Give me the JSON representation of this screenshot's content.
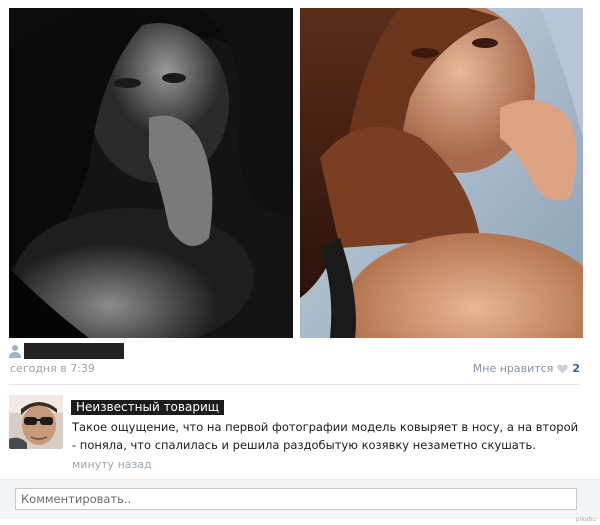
{
  "post": {
    "author_name": "",
    "time": "сегодня в 7:39",
    "like_label": "Мне нравится",
    "like_count": "2"
  },
  "comment": {
    "author": "Неизвестный товарищ",
    "text": "Такое ощущение, что на первой фотографии модель ковыряет в носу, а на второй - поняла, что спалилась и решила раздобытую козявку незаметно скушать.",
    "time": "минуту назад"
  },
  "comment_form": {
    "placeholder": "Комментировать.."
  },
  "watermark": "pikabu",
  "icons": {
    "author": "person-icon",
    "like": "heart-icon"
  },
  "colors": {
    "link": "#3b5f8a",
    "muted": "#9aa5b1",
    "heart": "#c9d3de"
  }
}
